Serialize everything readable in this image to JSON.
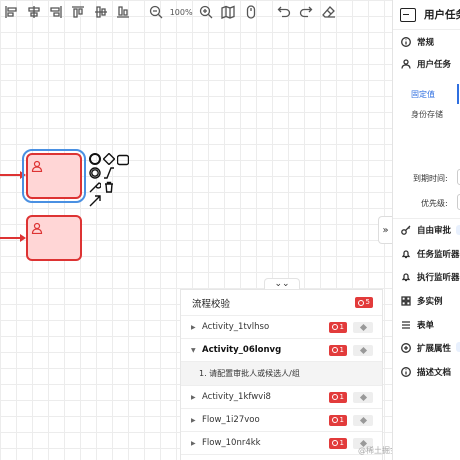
{
  "toolbar": {
    "zoom_label": "100%",
    "buttons": [
      "align-left-icon",
      "align-center-icon",
      "align-right-icon",
      "align-top-icon",
      "align-middle-icon",
      "align-bottom-icon",
      "zoom-out-icon",
      "zoom-in-icon",
      "map-icon",
      "mouse-icon",
      "undo-icon",
      "redo-icon",
      "eraser-icon"
    ]
  },
  "validation": {
    "title": "流程校验",
    "total_errors": "5",
    "rows": [
      {
        "name": "Activity_1tvlhso",
        "errors": "1",
        "expanded": false
      },
      {
        "name": "Activity_06lonvg",
        "errors": "1",
        "expanded": true,
        "detail": "1. 请配置审批人或候选人/组"
      },
      {
        "name": "Activity_1kfwvi8",
        "errors": "1",
        "expanded": false
      },
      {
        "name": "Flow_1i27voo",
        "errors": "1",
        "expanded": false
      },
      {
        "name": "Flow_10nr4kk",
        "errors": "1",
        "expanded": false
      }
    ]
  },
  "side": {
    "title": "用户任务",
    "sections": {
      "general": "常规",
      "user_task": "用户任务",
      "free_approval": "自由审批",
      "task_listener": "任务监听器",
      "exec_listener": "执行监听器",
      "multi_instance": "多实例",
      "form": "表单",
      "ext_props": "扩展属性",
      "description": "描述文档"
    },
    "tabs": {
      "fixed": "固定值",
      "identity": "身份存储"
    },
    "fields": {
      "due_time": "到期时间:",
      "priority": "优先级:"
    }
  },
  "canvas": {
    "collapse_symbol": "»",
    "panel_toggle_symbol": "⌄⌄"
  },
  "watermark": "@稀土掘金技术社区",
  "colors": {
    "error": "#e23b3b",
    "task_fill": "#ffd6d6",
    "task_stroke": "#dd3333",
    "selected": "#4a90e2",
    "accent": "#2f6fe0"
  }
}
